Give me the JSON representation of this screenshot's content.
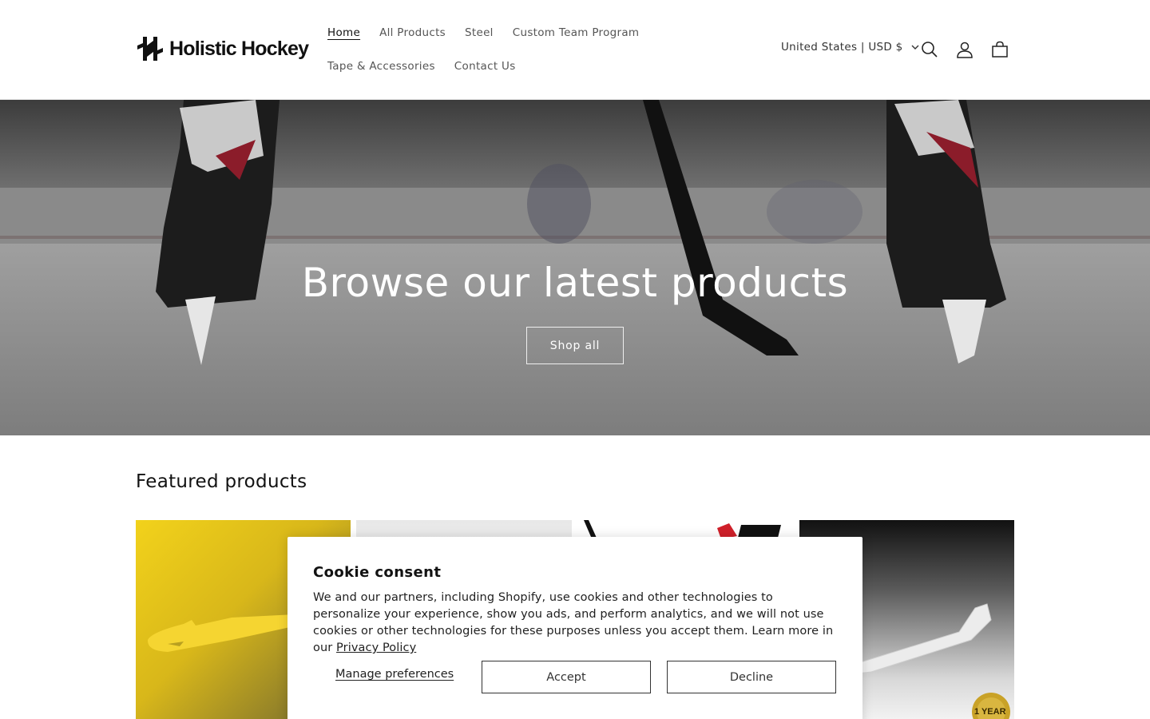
{
  "brand": {
    "name": "Holistic Hockey"
  },
  "nav": {
    "items": [
      {
        "label": "Home",
        "active": true
      },
      {
        "label": "All Products"
      },
      {
        "label": "Steel"
      },
      {
        "label": "Custom Team Program"
      },
      {
        "label": "Tape & Accessories"
      },
      {
        "label": "Contact Us"
      }
    ]
  },
  "header": {
    "locale_label": "United States | USD $",
    "icons": [
      "search-icon",
      "account-icon",
      "cart-icon"
    ]
  },
  "hero": {
    "title": "Browse our latest products",
    "button_label": "Shop all"
  },
  "featured": {
    "title": "Featured products",
    "cards": [
      {
        "name": "yellow-blade",
        "badge": ""
      },
      {
        "name": "white-blade",
        "badge": ""
      },
      {
        "name": "branded-blade",
        "badge": ""
      },
      {
        "name": "steel-blade",
        "badge": "1 YEAR"
      }
    ]
  },
  "cookie": {
    "title": "Cookie consent",
    "body": "We and our partners, including Shopify, use cookies and other technologies to personalize your experience, show you ads, and perform analytics, and we will not use cookies or other technologies for these purposes unless you accept them. Learn more in our ",
    "link_label": "Privacy Policy",
    "manage_label": "Manage preferences",
    "accept_label": "Accept",
    "decline_label": "Decline"
  }
}
